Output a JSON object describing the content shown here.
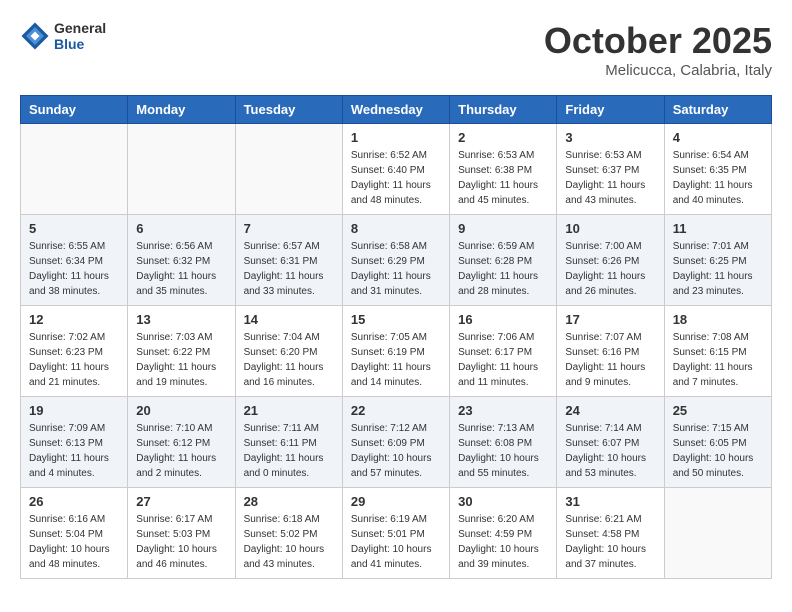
{
  "header": {
    "logo_general": "General",
    "logo_blue": "Blue",
    "month_title": "October 2025",
    "location": "Melicucca, Calabria, Italy"
  },
  "weekdays": [
    "Sunday",
    "Monday",
    "Tuesday",
    "Wednesday",
    "Thursday",
    "Friday",
    "Saturday"
  ],
  "weeks": [
    [
      {
        "day": "",
        "info": ""
      },
      {
        "day": "",
        "info": ""
      },
      {
        "day": "",
        "info": ""
      },
      {
        "day": "1",
        "info": "Sunrise: 6:52 AM\nSunset: 6:40 PM\nDaylight: 11 hours\nand 48 minutes."
      },
      {
        "day": "2",
        "info": "Sunrise: 6:53 AM\nSunset: 6:38 PM\nDaylight: 11 hours\nand 45 minutes."
      },
      {
        "day": "3",
        "info": "Sunrise: 6:53 AM\nSunset: 6:37 PM\nDaylight: 11 hours\nand 43 minutes."
      },
      {
        "day": "4",
        "info": "Sunrise: 6:54 AM\nSunset: 6:35 PM\nDaylight: 11 hours\nand 40 minutes."
      }
    ],
    [
      {
        "day": "5",
        "info": "Sunrise: 6:55 AM\nSunset: 6:34 PM\nDaylight: 11 hours\nand 38 minutes."
      },
      {
        "day": "6",
        "info": "Sunrise: 6:56 AM\nSunset: 6:32 PM\nDaylight: 11 hours\nand 35 minutes."
      },
      {
        "day": "7",
        "info": "Sunrise: 6:57 AM\nSunset: 6:31 PM\nDaylight: 11 hours\nand 33 minutes."
      },
      {
        "day": "8",
        "info": "Sunrise: 6:58 AM\nSunset: 6:29 PM\nDaylight: 11 hours\nand 31 minutes."
      },
      {
        "day": "9",
        "info": "Sunrise: 6:59 AM\nSunset: 6:28 PM\nDaylight: 11 hours\nand 28 minutes."
      },
      {
        "day": "10",
        "info": "Sunrise: 7:00 AM\nSunset: 6:26 PM\nDaylight: 11 hours\nand 26 minutes."
      },
      {
        "day": "11",
        "info": "Sunrise: 7:01 AM\nSunset: 6:25 PM\nDaylight: 11 hours\nand 23 minutes."
      }
    ],
    [
      {
        "day": "12",
        "info": "Sunrise: 7:02 AM\nSunset: 6:23 PM\nDaylight: 11 hours\nand 21 minutes."
      },
      {
        "day": "13",
        "info": "Sunrise: 7:03 AM\nSunset: 6:22 PM\nDaylight: 11 hours\nand 19 minutes."
      },
      {
        "day": "14",
        "info": "Sunrise: 7:04 AM\nSunset: 6:20 PM\nDaylight: 11 hours\nand 16 minutes."
      },
      {
        "day": "15",
        "info": "Sunrise: 7:05 AM\nSunset: 6:19 PM\nDaylight: 11 hours\nand 14 minutes."
      },
      {
        "day": "16",
        "info": "Sunrise: 7:06 AM\nSunset: 6:17 PM\nDaylight: 11 hours\nand 11 minutes."
      },
      {
        "day": "17",
        "info": "Sunrise: 7:07 AM\nSunset: 6:16 PM\nDaylight: 11 hours\nand 9 minutes."
      },
      {
        "day": "18",
        "info": "Sunrise: 7:08 AM\nSunset: 6:15 PM\nDaylight: 11 hours\nand 7 minutes."
      }
    ],
    [
      {
        "day": "19",
        "info": "Sunrise: 7:09 AM\nSunset: 6:13 PM\nDaylight: 11 hours\nand 4 minutes."
      },
      {
        "day": "20",
        "info": "Sunrise: 7:10 AM\nSunset: 6:12 PM\nDaylight: 11 hours\nand 2 minutes."
      },
      {
        "day": "21",
        "info": "Sunrise: 7:11 AM\nSunset: 6:11 PM\nDaylight: 11 hours\nand 0 minutes."
      },
      {
        "day": "22",
        "info": "Sunrise: 7:12 AM\nSunset: 6:09 PM\nDaylight: 10 hours\nand 57 minutes."
      },
      {
        "day": "23",
        "info": "Sunrise: 7:13 AM\nSunset: 6:08 PM\nDaylight: 10 hours\nand 55 minutes."
      },
      {
        "day": "24",
        "info": "Sunrise: 7:14 AM\nSunset: 6:07 PM\nDaylight: 10 hours\nand 53 minutes."
      },
      {
        "day": "25",
        "info": "Sunrise: 7:15 AM\nSunset: 6:05 PM\nDaylight: 10 hours\nand 50 minutes."
      }
    ],
    [
      {
        "day": "26",
        "info": "Sunrise: 6:16 AM\nSunset: 5:04 PM\nDaylight: 10 hours\nand 48 minutes."
      },
      {
        "day": "27",
        "info": "Sunrise: 6:17 AM\nSunset: 5:03 PM\nDaylight: 10 hours\nand 46 minutes."
      },
      {
        "day": "28",
        "info": "Sunrise: 6:18 AM\nSunset: 5:02 PM\nDaylight: 10 hours\nand 43 minutes."
      },
      {
        "day": "29",
        "info": "Sunrise: 6:19 AM\nSunset: 5:01 PM\nDaylight: 10 hours\nand 41 minutes."
      },
      {
        "day": "30",
        "info": "Sunrise: 6:20 AM\nSunset: 4:59 PM\nDaylight: 10 hours\nand 39 minutes."
      },
      {
        "day": "31",
        "info": "Sunrise: 6:21 AM\nSunset: 4:58 PM\nDaylight: 10 hours\nand 37 minutes."
      },
      {
        "day": "",
        "info": ""
      }
    ]
  ]
}
